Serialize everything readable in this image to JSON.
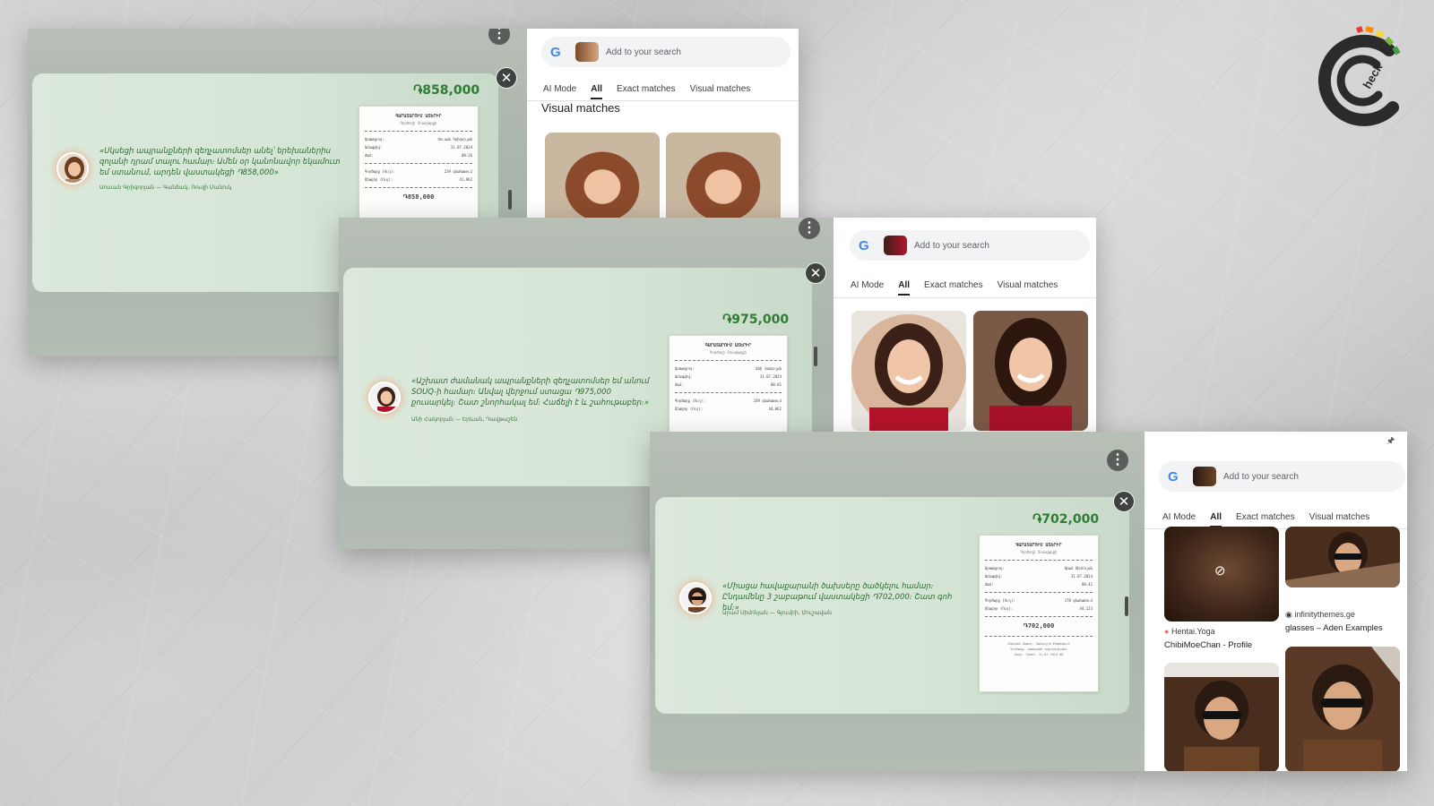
{
  "panels": [
    {
      "amount": "֏858,000",
      "quote": "«Սկսեցի ապրանքների զեղչատոմսեր անել՝ երեխաներիս զոլանի դրամ տալու համար։ Ամեն օր կանոնավոր եկամուտ եմ ստանում, արդեն վաստակեցի ֏858,000»",
      "author": "Սուսան Գրիգորյան — Գանձակ, Ռուզի Մանուկ",
      "receipt": {
        "title": "ԳԱՐԱՏԱՐՈՒՄ ԱՏԵՐԻՐ",
        "subtitle": "Գործողի Չոսսվարքի",
        "rows": [
          [
            "Արտադրող:",
            "Սուսան Գրիգորյան"
          ],
          [
            "Ամսաթիվ:",
            "31.07.2024"
          ],
          [
            "Ժամ:",
            "08:26"
          ]
        ],
        "rows2": [
          [
            "Գործարք (Ուղ):",
            "239 գնահատում"
          ],
          [
            "Միավոր (Ուղ):",
            "41,962"
          ]
        ],
        "total": "֏858,000"
      },
      "search": {
        "placeholder": "Add to your search",
        "tabs": [
          "AI Mode",
          "All",
          "Exact matches",
          "Visual matches"
        ],
        "heading": "Visual matches"
      }
    },
    {
      "amount": "֏975,000",
      "quote": "«Աշխատ ժամանակ ապրանքների զեղչատոմսեր եմ անում SOUQ-ի համար։ Անվալ վերջում ստացա ֏975,000 քուսարկել։ Շատ շնորհակալ եմ։ Հաճելի է և շահութաբեր։»",
      "author": "Անի Հակոբյան — Երևան, Դավթաշեն",
      "receipt": {
        "title": "ԳԱՐԱՏԱՐՈՒՄ ԱՏԵՐԻՐ",
        "subtitle": "Գործողի Չոսսվարքի",
        "rows": [
          [
            "Արտադրող:",
            "Անի Հակոբյան"
          ],
          [
            "Ամսաթիվ:",
            "31.07.2024"
          ],
          [
            "Ժամ:",
            "08:01"
          ]
        ],
        "rows2": [
          [
            "Գործարք (Ուղ):",
            "249 գնահատում"
          ],
          [
            "Միավոր (Ուղ):",
            "44,062"
          ]
        ],
        "total": "֏975,000"
      },
      "search": {
        "placeholder": "Add to your search",
        "tabs": [
          "AI Mode",
          "All",
          "Exact matches",
          "Visual matches"
        ]
      }
    },
    {
      "amount": "֏702,000",
      "quote": "«Միացա հավաքարանի ծախսերը ծածկելու համար։ Ընդամենը 3 շաբաթում վաստակեցի ֏702,000։ Շատ գոհ եմ։»",
      "author": "Արամ Սիմոնյան — Գյումրի, Մուշավան",
      "receipt": {
        "title": "ԳԱՐԱՏԱՐՈՒՄ ԱՏԵՐԻՐ",
        "subtitle": "Գործողի Չոսսվարքի",
        "rows": [
          [
            "Արտադրող:",
            "Արամ Սիմոնյան"
          ],
          [
            "Ամսաթիվ:",
            "31.07.2024"
          ],
          [
            "Ժամ:",
            "08:41"
          ]
        ],
        "rows2": [
          [
            "Գործարք (Ուղ):",
            "170 գնահատում"
          ],
          [
            "Միավոր (Ուղ):",
            "44,123"
          ]
        ],
        "total": "֏702,000",
        "footer1": "Վճարման Մեթոդ։ Բանկային Փոխանցում",
        "footer2": "Գործարք: Կատարված Հաջողությամբ",
        "footer3": "Տեղի: Tweet: 31.07.2024 08"
      },
      "search": {
        "placeholder": "Add to your search",
        "tabs": [
          "AI Mode",
          "All",
          "Exact matches",
          "Visual matches"
        ],
        "results": [
          {
            "source": "Hentai.Yoga",
            "title": "ChibiMoeChan - Profile"
          },
          {
            "source": "infinitythemes.ge",
            "title": "glasses – Aden Examples"
          }
        ]
      }
    }
  ],
  "icons": {
    "kebab": "⋮",
    "close": "✕",
    "pin": "🖈",
    "hidden": "⊘",
    "google": "G"
  },
  "colors": {
    "amount_green": "#2e7d32",
    "quote_green": "#2e6b35",
    "modal_bg": "#d6e6d6",
    "panel_bg": "#aeb8ae"
  }
}
